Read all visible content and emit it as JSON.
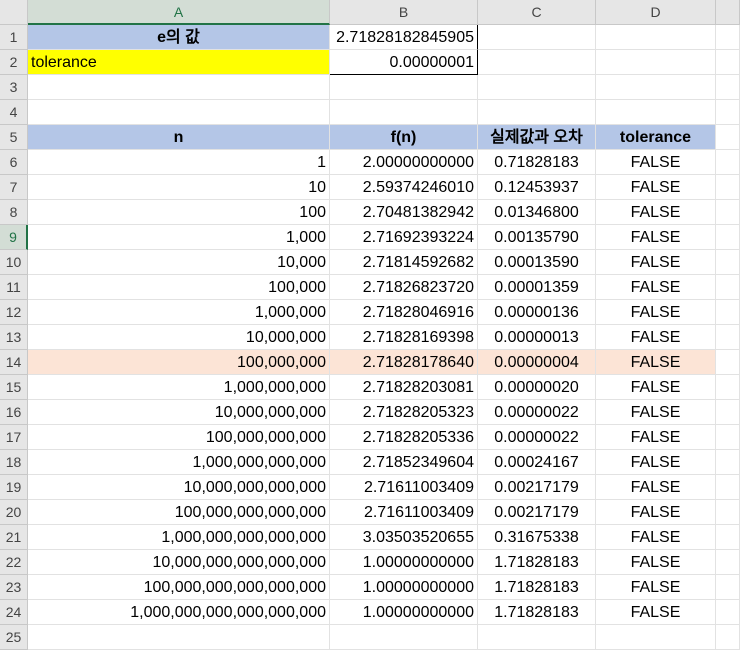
{
  "columns": [
    "A",
    "B",
    "C",
    "D"
  ],
  "rows": [
    {
      "n": "1",
      "a": "e의 값",
      "b": "2.71828182845905",
      "c": "",
      "d": ""
    },
    {
      "n": "2",
      "a": "tolerance",
      "b": "0.00000001",
      "c": "",
      "d": ""
    },
    {
      "n": "3",
      "a": "",
      "b": "",
      "c": "",
      "d": ""
    },
    {
      "n": "4",
      "a": "",
      "b": "",
      "c": "",
      "d": ""
    },
    {
      "n": "5",
      "a": "n",
      "b": "f(n)",
      "c": "실제값과 오차",
      "d": "tolerance"
    },
    {
      "n": "6",
      "a": "1",
      "b": "2.00000000000",
      "c": "0.71828183",
      "d": "FALSE"
    },
    {
      "n": "7",
      "a": "10",
      "b": "2.59374246010",
      "c": "0.12453937",
      "d": "FALSE"
    },
    {
      "n": "8",
      "a": "100",
      "b": "2.70481382942",
      "c": "0.01346800",
      "d": "FALSE"
    },
    {
      "n": "9",
      "a": "1,000",
      "b": "2.71692393224",
      "c": "0.00135790",
      "d": "FALSE"
    },
    {
      "n": "10",
      "a": "10,000",
      "b": "2.71814592682",
      "c": "0.00013590",
      "d": "FALSE"
    },
    {
      "n": "11",
      "a": "100,000",
      "b": "2.71826823720",
      "c": "0.00001359",
      "d": "FALSE"
    },
    {
      "n": "12",
      "a": "1,000,000",
      "b": "2.71828046916",
      "c": "0.00000136",
      "d": "FALSE"
    },
    {
      "n": "13",
      "a": "10,000,000",
      "b": "2.71828169398",
      "c": "0.00000013",
      "d": "FALSE"
    },
    {
      "n": "14",
      "a": "100,000,000",
      "b": "2.71828178640",
      "c": "0.00000004",
      "d": "FALSE"
    },
    {
      "n": "15",
      "a": "1,000,000,000",
      "b": "2.71828203081",
      "c": "0.00000020",
      "d": "FALSE"
    },
    {
      "n": "16",
      "a": "10,000,000,000",
      "b": "2.71828205323",
      "c": "0.00000022",
      "d": "FALSE"
    },
    {
      "n": "17",
      "a": "100,000,000,000",
      "b": "2.71828205336",
      "c": "0.00000022",
      "d": "FALSE"
    },
    {
      "n": "18",
      "a": "1,000,000,000,000",
      "b": "2.71852349604",
      "c": "0.00024167",
      "d": "FALSE"
    },
    {
      "n": "19",
      "a": "10,000,000,000,000",
      "b": "2.71611003409",
      "c": "0.00217179",
      "d": "FALSE"
    },
    {
      "n": "20",
      "a": "100,000,000,000,000",
      "b": "2.71611003409",
      "c": "0.00217179",
      "d": "FALSE"
    },
    {
      "n": "21",
      "a": "1,000,000,000,000,000",
      "b": "3.03503520655",
      "c": "0.31675338",
      "d": "FALSE"
    },
    {
      "n": "22",
      "a": "10,000,000,000,000,000",
      "b": "1.00000000000",
      "c": "1.71828183",
      "d": "FALSE"
    },
    {
      "n": "23",
      "a": "100,000,000,000,000,000",
      "b": "1.00000000000",
      "c": "1.71828183",
      "d": "FALSE"
    },
    {
      "n": "24",
      "a": "1,000,000,000,000,000,000",
      "b": "1.00000000000",
      "c": "1.71828183",
      "d": "FALSE"
    },
    {
      "n": "25",
      "a": "",
      "b": "",
      "c": "",
      "d": ""
    }
  ],
  "colors": {
    "header_fill": "#b4c6e7",
    "tolerance_fill": "#ffff00",
    "highlight_row_fill": "#fce4d6",
    "selection_green": "#217346"
  }
}
